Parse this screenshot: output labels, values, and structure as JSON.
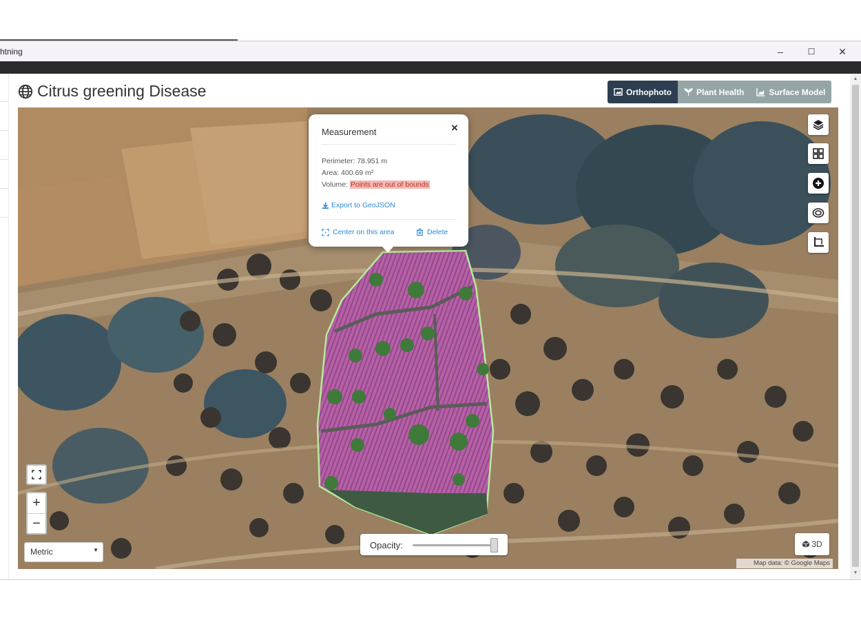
{
  "window": {
    "title": "htning",
    "minimize_label": "–",
    "maximize_label": "☐",
    "close_label": "✕"
  },
  "page": {
    "title": "Citrus greening Disease",
    "icon": "globe-icon"
  },
  "layers_toggle": {
    "orthophoto": "Orthophoto",
    "plant_health": "Plant Health",
    "surface_model": "Surface Model",
    "active": "Orthophoto",
    "active_color": "#2c3e50",
    "inactive_color": "#95a5a6"
  },
  "measurement_popup": {
    "title": "Measurement",
    "close": "×",
    "perimeter": "Perimeter: 78.951 m",
    "area": "Area: 400.69 m²",
    "volume_label": "Volume: ",
    "volume_value": "Points are out of bounds",
    "export": "Export to GeoJSON",
    "center": "Center on this area",
    "delete": "Delete",
    "link_color": "#2c8ad8",
    "warning_bg": "#f5b7b1"
  },
  "map_tools": [
    "layers-icon",
    "grid-icon",
    "plus-circle-icon",
    "target-icon",
    "crop-icon"
  ],
  "zoom": {
    "in": "+",
    "out": "−"
  },
  "units": {
    "selected": "Metric"
  },
  "opacity": {
    "label": "Opacity:",
    "value": 1.0
  },
  "view3d": {
    "label": "3D"
  },
  "attribution": "Map data: © Google Maps",
  "polygon_color": "#b6ec9c"
}
